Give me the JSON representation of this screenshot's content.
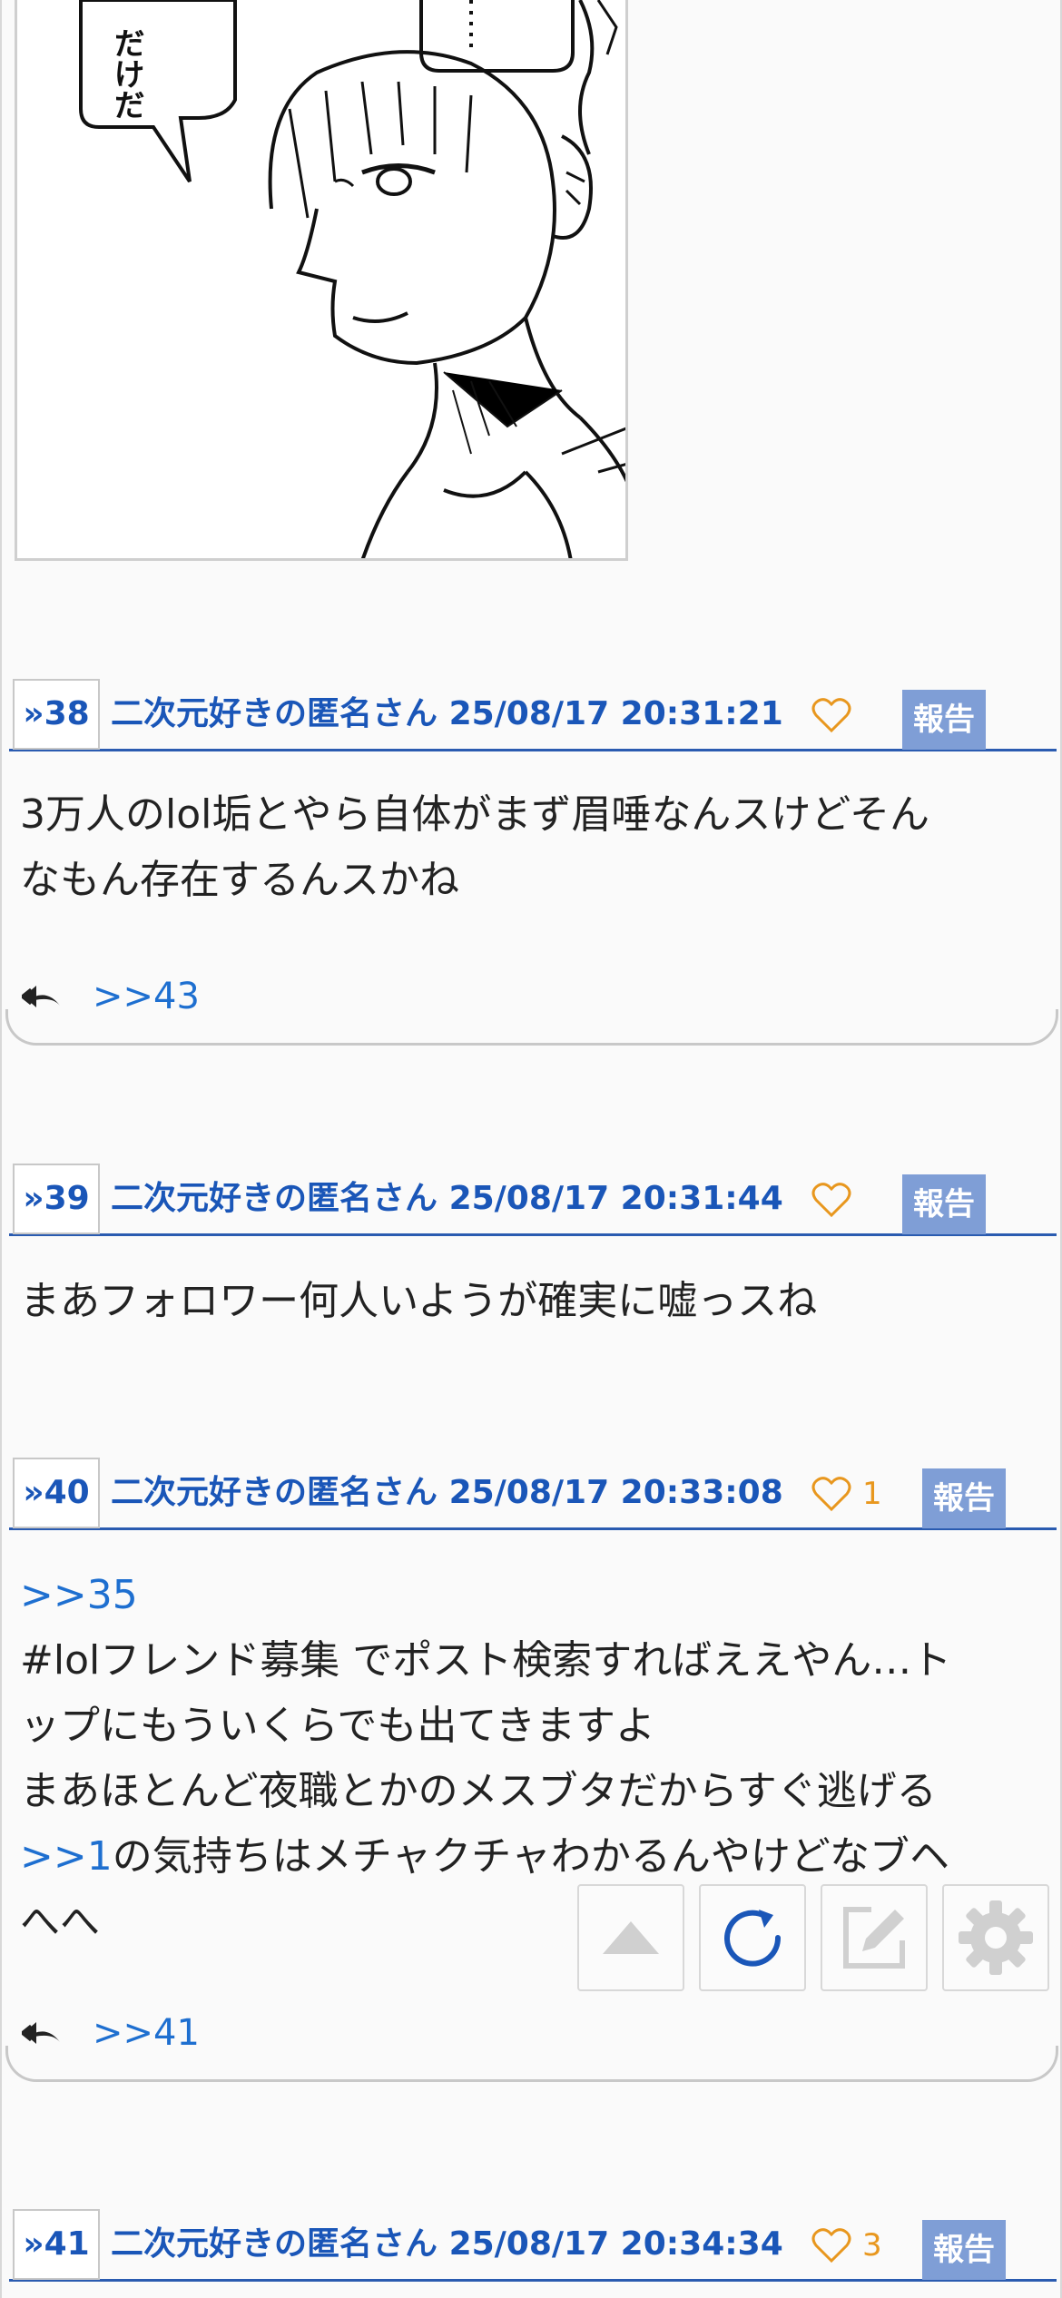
{
  "posts": [
    {
      "number_label": "»38",
      "name": "二次元好きの匿名さん",
      "datetime": "25/08/17 20:31:21",
      "likes": "",
      "report_label": "報告",
      "body_lines": [
        "3万人のlol垢とやら自体がまず眉唾なんスけどそん",
        "なもん存在するんスかね"
      ],
      "reply_link": ">>43"
    },
    {
      "number_label": "»39",
      "name": "二次元好きの匿名さん",
      "datetime": "25/08/17 20:31:44",
      "likes": "",
      "report_label": "報告",
      "body_lines": [
        "まあフォロワー何人いようが確実に嘘っスね"
      ]
    },
    {
      "number_label": "»40",
      "name": "二次元好きの匿名さん",
      "datetime": "25/08/17 20:33:08",
      "likes": "1",
      "report_label": "報告",
      "anchor_line": ">>35",
      "body_lines": [
        "#lolフレンド募集 でポスト検索すればええやん…ト",
        "ップにもういくらでも出てきますよ",
        "まあほとんど夜職とかのメスブタだからすぐ逃げる"
      ],
      "anchor_inline": ">>1",
      "body_after_anchor": "の気持ちはメチャクチャわかるんやけどなブヘ",
      "body_tail": "へへ",
      "reply_link": ">>41"
    },
    {
      "number_label": "»41",
      "name": "二次元好きの匿名さん",
      "datetime": "25/08/17 20:34:34",
      "likes": "3",
      "report_label": "報告"
    }
  ],
  "floating_buttons": [
    {
      "name": "scroll-top",
      "icon": "triangle-up-icon"
    },
    {
      "name": "refresh",
      "icon": "refresh-icon"
    },
    {
      "name": "write",
      "icon": "pencil-icon"
    },
    {
      "name": "settings",
      "icon": "gear-icon"
    }
  ],
  "colors": {
    "accent": "#1a56b8",
    "link": "#1e6fd0",
    "heart": "#e8971e",
    "report": "#7f9ed6"
  }
}
